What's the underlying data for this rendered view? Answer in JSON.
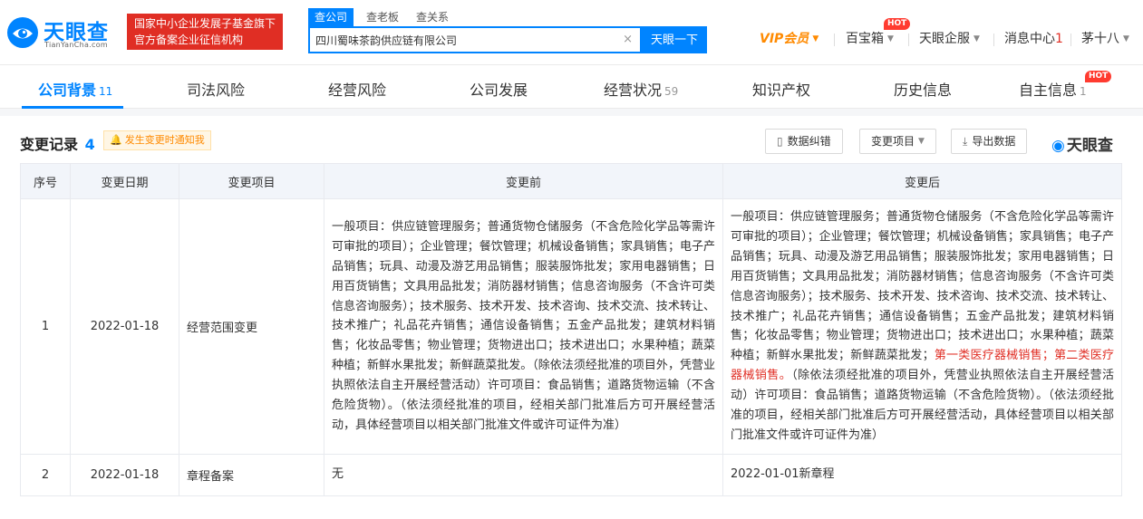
{
  "header": {
    "logo_text": "天眼查",
    "logo_sub": "TianYanCha.com",
    "banner_line1": "国家中小企业发展子基金旗下",
    "banner_line2": "官方备案企业征信机构",
    "search_tabs": [
      {
        "label": "查公司",
        "active": true
      },
      {
        "label": "查老板",
        "active": false
      },
      {
        "label": "查关系",
        "active": false
      }
    ],
    "search_value": "四川蜀味茶韵供应链有限公司",
    "search_button": "天眼一下",
    "nav": {
      "vip": "VIP会员",
      "baibaoxiang": "百宝箱",
      "hot_badge": "HOT",
      "enterprise": "天眼企服",
      "messages": "消息中心",
      "message_count": "1",
      "user": "茅十八"
    }
  },
  "subnav": {
    "items": [
      {
        "label": "公司背景",
        "count": "11",
        "active": true
      },
      {
        "label": "司法风险",
        "count": "",
        "active": false
      },
      {
        "label": "经营风险",
        "count": "",
        "active": false
      },
      {
        "label": "公司发展",
        "count": "",
        "active": false
      },
      {
        "label": "经营状况",
        "count": "59",
        "active": false
      },
      {
        "label": "知识产权",
        "count": "",
        "active": false
      },
      {
        "label": "历史信息",
        "count": "",
        "active": false
      },
      {
        "label": "自主信息",
        "count": "1",
        "active": false
      }
    ],
    "hot_badge": "HOT"
  },
  "section": {
    "title": "变更记录",
    "count": "4",
    "notify": "发生变更时通知我",
    "buttons": {
      "correction": "数据纠错",
      "change_item": "变更项目",
      "export": "导出数据"
    },
    "brand": "天眼查"
  },
  "table": {
    "headers": [
      "序号",
      "变更日期",
      "变更项目",
      "变更前",
      "变更后"
    ],
    "rows": [
      {
        "index": "1",
        "date": "2022-01-18",
        "item": "经营范围变更",
        "before": "一般项目：供应链管理服务；普通货物仓储服务（不含危险化学品等需许可审批的项目）；企业管理；餐饮管理；机械设备销售；家具销售；电子产品销售；玩具、动漫及游艺用品销售；服装服饰批发；家用电器销售；日用百货销售；文具用品批发；消防器材销售；信息咨询服务（不含许可类信息咨询服务）；技术服务、技术开发、技术咨询、技术交流、技术转让、技术推广；礼品花卉销售；通信设备销售；五金产品批发；建筑材料销售；化妆品零售；物业管理；货物进出口；技术进出口；水果种植；蔬菜种植；新鲜水果批发；新鲜蔬菜批发。（除依法须经批准的项目外，凭营业执照依法自主开展经营活动）许可项目：食品销售；道路货物运输（不含危险货物）。（依法须经批准的项目，经相关部门批准后方可开展经营活动，具体经营项目以相关部门批准文件或许可证件为准）",
        "after_a": "一般项目：供应链管理服务；普通货物仓储服务（不含危险化学品等需许可审批的项目）；企业管理；餐饮管理；机械设备销售；家具销售；电子产品销售；玩具、动漫及游艺用品销售；服装服饰批发；家用电器销售；日用百货销售；文具用品批发；消防器材销售；信息咨询服务（不含许可类信息咨询服务）；技术服务、技术开发、技术咨询、技术交流、技术转让、技术推广；礼品花卉销售；通信设备销售；五金产品批发；建筑材料销售；化妆品零售；物业管理；货物进出口；技术进出口；水果种植；蔬菜种植；新鲜水果批发；新鲜蔬菜批发；",
        "after_highlight": "第一类医疗器械销售；第二类医疗器械销售。",
        "after_b": "（除依法须经批准的项目外，凭营业执照依法自主开展经营活动）许可项目：食品销售；道路货物运输（不含危险货物）。（依法须经批准的项目，经相关部门批准后方可开展经营活动，具体经营项目以相关部门批准文件或许可证件为准）"
      },
      {
        "index": "2",
        "date": "2022-01-18",
        "item": "章程备案",
        "before": "无",
        "after": "2022-01-01新章程"
      }
    ]
  },
  "colors": {
    "brand_blue": "#0084ff",
    "banner_red": "#e02e24",
    "vip_orange": "#ff8a00",
    "highlight_red": "#e02e24"
  }
}
